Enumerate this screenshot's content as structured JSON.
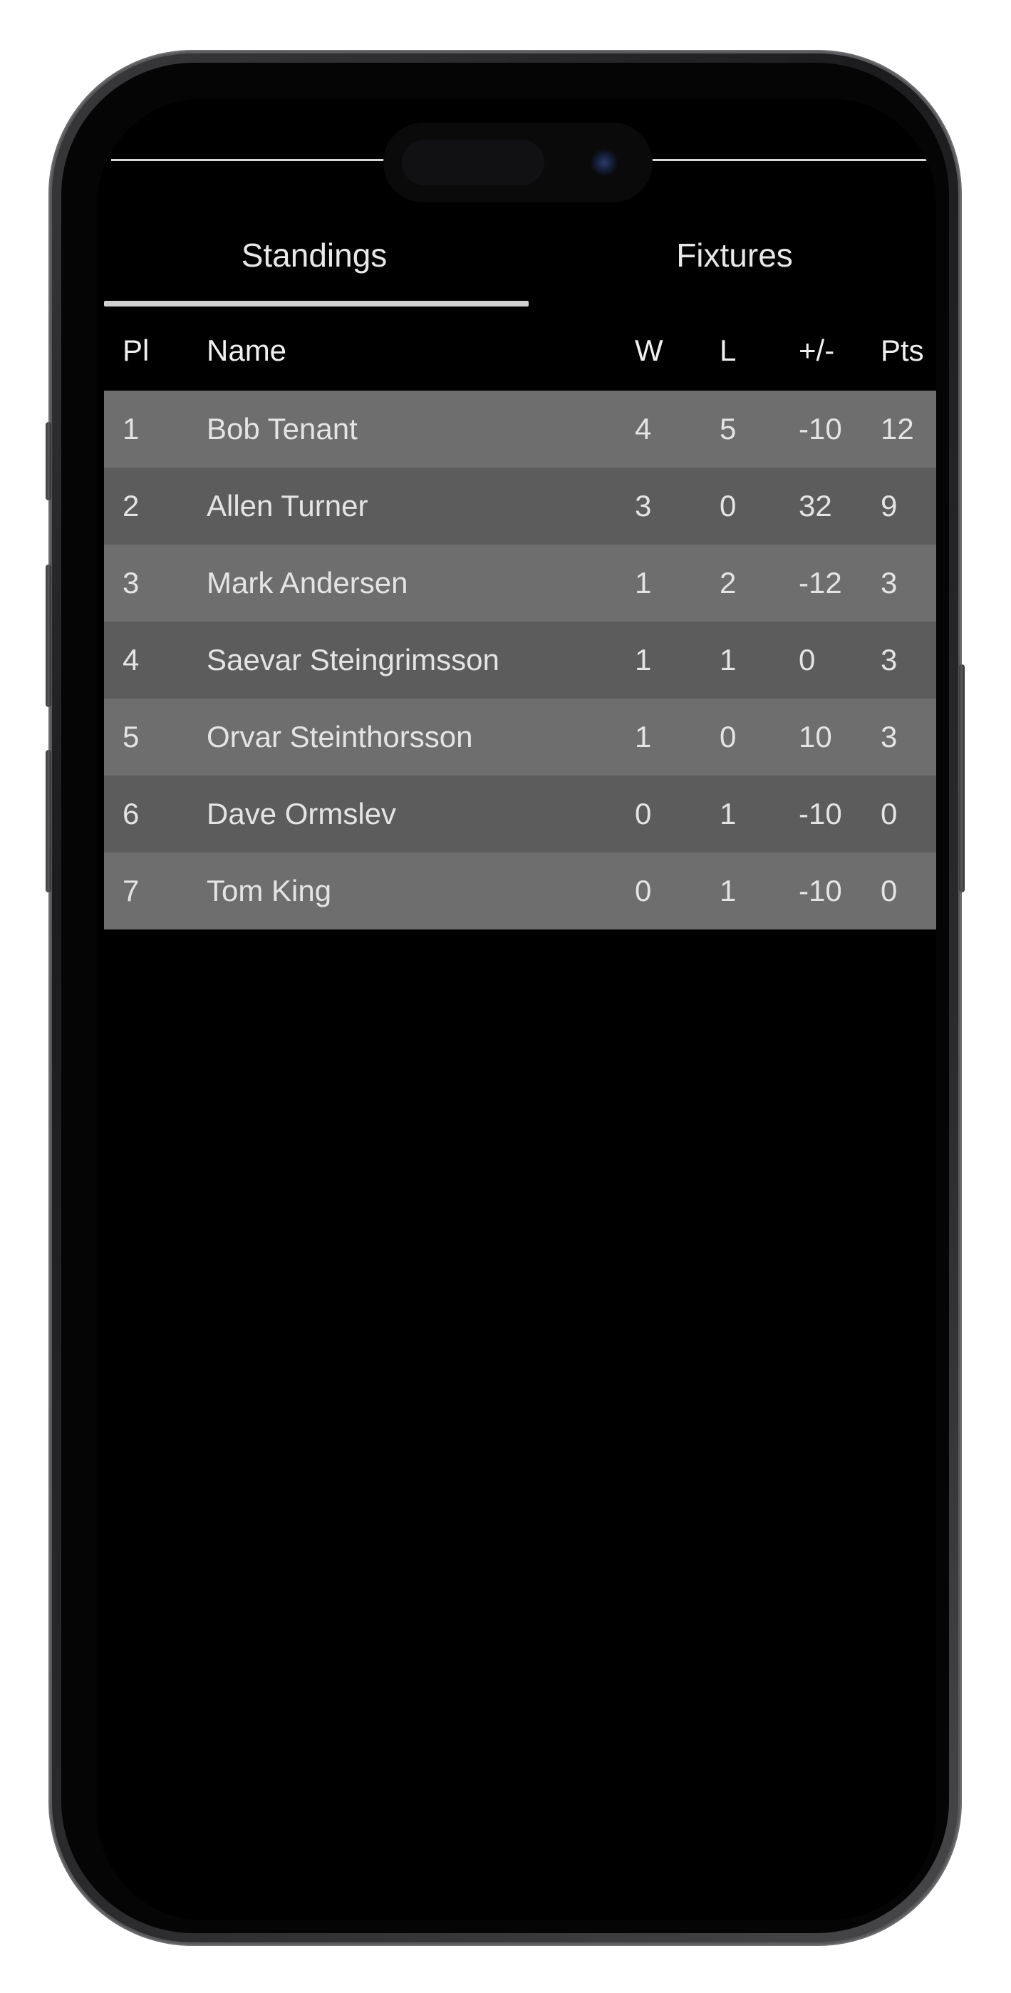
{
  "tabs": [
    {
      "label": "Standings",
      "active": true
    },
    {
      "label": "Fixtures",
      "active": false
    }
  ],
  "table": {
    "headers": {
      "pos": "Pl",
      "name": "Name",
      "w": "W",
      "l": "L",
      "gd": "+/-",
      "pts": "Pts"
    },
    "rows": [
      {
        "pos": "1",
        "name": "Bob Tenant",
        "w": "4",
        "l": "5",
        "gd": "-10",
        "pts": "12"
      },
      {
        "pos": "2",
        "name": "Allen Turner",
        "w": "3",
        "l": "0",
        "gd": "32",
        "pts": "9"
      },
      {
        "pos": "3",
        "name": "Mark Andersen",
        "w": "1",
        "l": "2",
        "gd": "-12",
        "pts": "3"
      },
      {
        "pos": "4",
        "name": "Saevar Steingrimsson",
        "w": "1",
        "l": "1",
        "gd": "0",
        "pts": "3"
      },
      {
        "pos": "5",
        "name": "Orvar Steinthorsson",
        "w": "1",
        "l": "0",
        "gd": "10",
        "pts": "3"
      },
      {
        "pos": "6",
        "name": "Dave Ormslev",
        "w": "0",
        "l": "1",
        "gd": "-10",
        "pts": "0"
      },
      {
        "pos": "7",
        "name": "Tom King",
        "w": "0",
        "l": "1",
        "gd": "-10",
        "pts": "0"
      }
    ]
  },
  "colors": {
    "background": "#000000",
    "row_odd": "#6e6e6e",
    "row_even": "#5c5c5c",
    "text": "#e4e4e4"
  }
}
